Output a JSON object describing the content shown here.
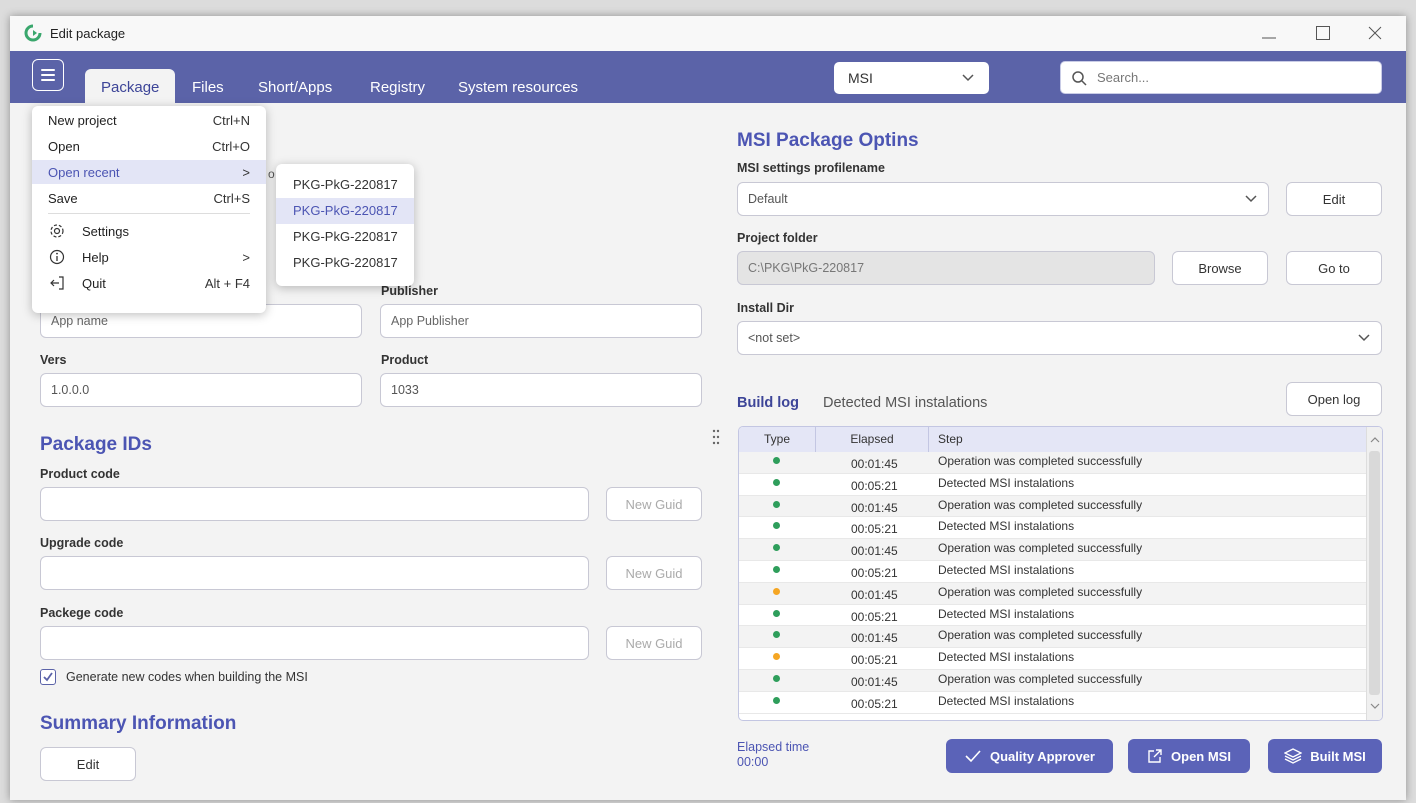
{
  "window": {
    "title": "Edit package"
  },
  "nav": {
    "tabs": [
      "Package",
      "Files",
      "Short/Apps",
      "Registry",
      "System resources"
    ],
    "build_type": "MSI",
    "search_placeholder": "Search..."
  },
  "menu": {
    "items": [
      {
        "label": "New project",
        "shortcut": "Ctrl+N"
      },
      {
        "label": "Open",
        "shortcut": "Ctrl+O"
      },
      {
        "label": "Open recent",
        "shortcut": ">"
      },
      {
        "label": "Save",
        "shortcut": "Ctrl+S"
      },
      {
        "label": "Settings",
        "shortcut": ""
      },
      {
        "label": "Help",
        "shortcut": ">"
      },
      {
        "label": "Quit",
        "shortcut": "Alt + F4"
      }
    ],
    "recent": [
      "PKG-PkG-220817",
      "PKG-PkG-220817",
      "PKG-PkG-220817",
      "PKG-PkG-220817"
    ],
    "peek_text": "o"
  },
  "left": {
    "publisher_label": "Publisher",
    "app_name_placeholder": "App name",
    "publisher_placeholder": "App Publisher",
    "version_label": "Vers",
    "version_value": "1.0.0.0",
    "product_label": "Product",
    "product_value": "1033",
    "package_ids_title": "Package IDs",
    "product_code_label": "Product code",
    "upgrade_code_label": "Upgrade code",
    "package_code_label": "Packege code",
    "new_guid": "New Guid",
    "generate_label": "Generate new codes when building the MSI",
    "summary_title": "Summary Information",
    "edit_label": "Edit"
  },
  "right": {
    "title": "MSI Package Optins",
    "profile_label": "MSI settings profilename",
    "profile_value": "Default",
    "edit_label": "Edit",
    "project_folder_label": "Project folder",
    "project_folder_value": "C:\\PKG\\PkG-220817",
    "browse_label": "Browse",
    "goto_label": "Go to",
    "install_dir_label": "Install Dir",
    "install_dir_value": "<not set>",
    "log_tabs": [
      "Build log",
      "Detected MSI instalations"
    ],
    "open_log": "Open log",
    "columns": [
      "Type",
      "Elapsed",
      "Step"
    ],
    "rows": [
      {
        "status": "green",
        "elapsed": "00:01:45",
        "step": "Operation was completed successfully"
      },
      {
        "status": "green",
        "elapsed": "00:05:21",
        "step": "Detected MSI instalations"
      },
      {
        "status": "green",
        "elapsed": "00:01:45",
        "step": "Operation was completed successfully"
      },
      {
        "status": "green",
        "elapsed": "00:05:21",
        "step": "Detected MSI instalations"
      },
      {
        "status": "green",
        "elapsed": "00:01:45",
        "step": "Operation was completed successfully"
      },
      {
        "status": "green",
        "elapsed": "00:05:21",
        "step": "Detected MSI instalations"
      },
      {
        "status": "orange",
        "elapsed": "00:01:45",
        "step": "Operation was completed successfully"
      },
      {
        "status": "green",
        "elapsed": "00:05:21",
        "step": "Detected MSI instalations"
      },
      {
        "status": "green",
        "elapsed": "00:01:45",
        "step": "Operation was completed successfully"
      },
      {
        "status": "orange",
        "elapsed": "00:05:21",
        "step": "Detected MSI instalations"
      },
      {
        "status": "green",
        "elapsed": "00:01:45",
        "step": "Operation was completed successfully"
      },
      {
        "status": "green",
        "elapsed": "00:05:21",
        "step": "Detected MSI instalations"
      }
    ],
    "elapsed_label": "Elapsed time",
    "elapsed_value": "00:00",
    "quality_approver": "Quality Approver",
    "open_msi": "Open MSI",
    "built_msi": "Built MSI"
  },
  "colors": {
    "accent": "#5b63a8",
    "status_green": "#2e9e5b",
    "status_orange": "#f5a623"
  }
}
